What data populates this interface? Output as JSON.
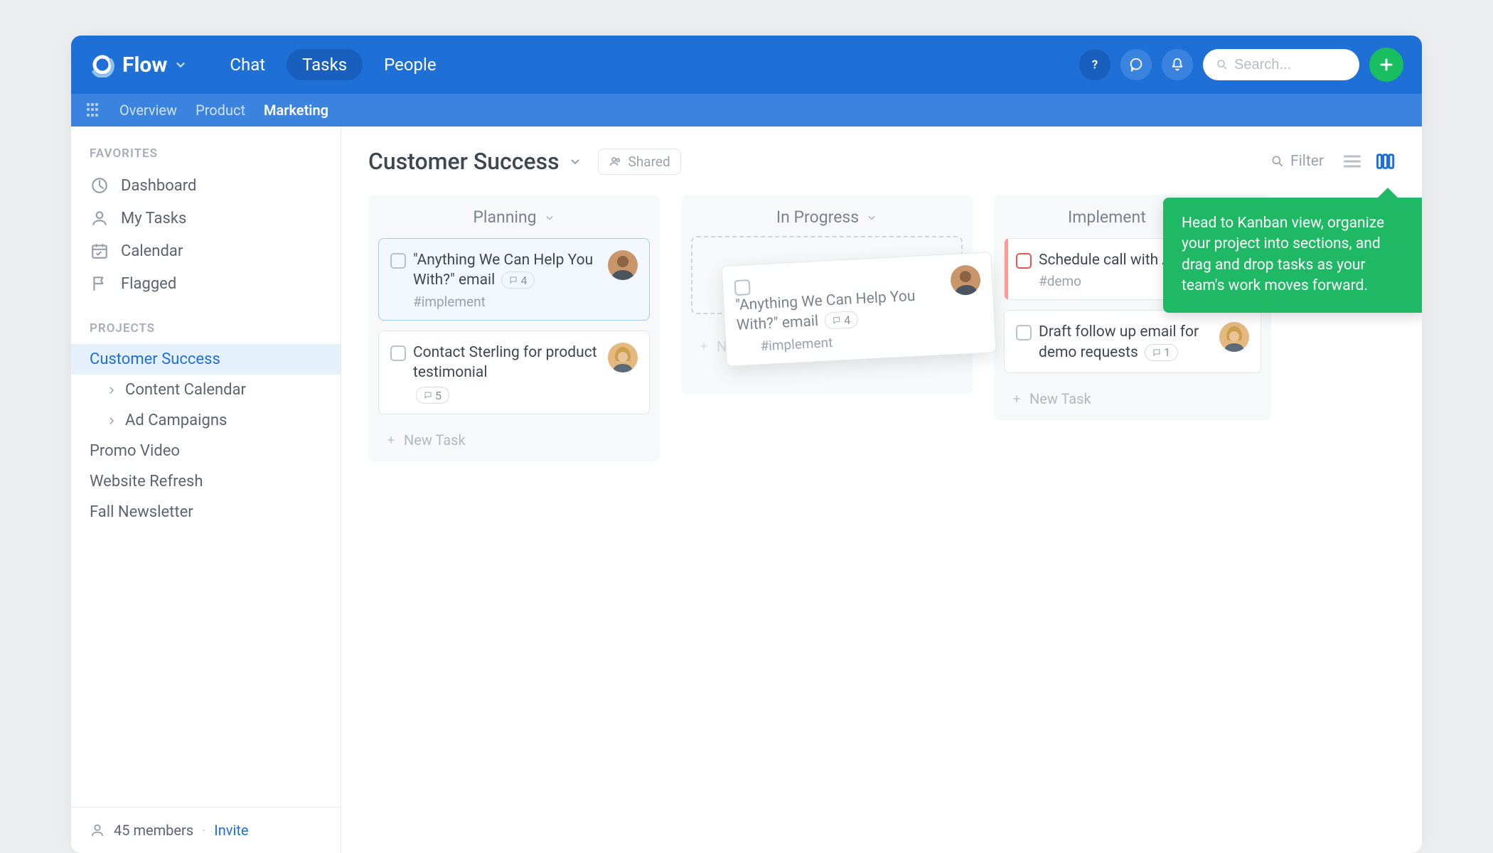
{
  "header": {
    "logo": "Flow",
    "nav": {
      "chat": "Chat",
      "tasks": "Tasks",
      "people": "People"
    },
    "search_placeholder": "Search..."
  },
  "subnav": {
    "overview": "Overview",
    "product": "Product",
    "marketing": "Marketing"
  },
  "sidebar": {
    "favorites_label": "FAVORITES",
    "favorites": {
      "dashboard": "Dashboard",
      "mytasks": "My Tasks",
      "calendar": "Calendar",
      "flagged": "Flagged"
    },
    "projects_label": "PROJECTS",
    "projects": {
      "customer_success": "Customer Success",
      "content_calendar": "Content Calendar",
      "ad_campaigns": "Ad Campaigns",
      "promo_video": "Promo Video",
      "website_refresh": "Website Refresh",
      "fall_newsletter": "Fall Newsletter"
    },
    "footer": {
      "members": "45 members",
      "invite": "Invite"
    }
  },
  "page": {
    "title": "Customer Success",
    "shared": "Shared",
    "filter": "Filter"
  },
  "columns": {
    "planning": {
      "title": "Planning",
      "cards": [
        {
          "text": "\"Anything We Can Help You With?\" email",
          "count": "4",
          "tag": "#implement"
        },
        {
          "text": "Contact Sterling for product testimonial",
          "count": "5"
        }
      ],
      "newtask": "New Task"
    },
    "in_progress": {
      "title": "In Progress",
      "newtask": "New Task",
      "drag_card": {
        "text": "\"Anything We Can Help You With?\" email",
        "count": "4",
        "tag": "#implement"
      }
    },
    "implement": {
      "title": "Implement",
      "cards": [
        {
          "text": "Schedule call with Al",
          "tag": "#demo"
        },
        {
          "text": "Draft follow up email for demo requests",
          "count": "1"
        }
      ],
      "newtask": "New Task"
    }
  },
  "tooltip": "Head to Kanban view, organize your project into sections, and drag and drop tasks as your team's work moves forward."
}
